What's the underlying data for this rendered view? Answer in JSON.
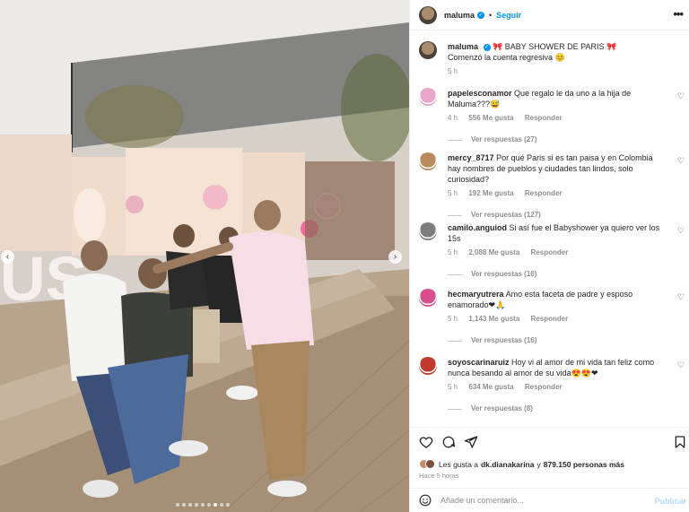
{
  "post_header": {
    "username": "maluma",
    "separator": "•",
    "follow_label": "Seguir",
    "more_label": "•••"
  },
  "caption": {
    "username": "maluma",
    "title": "🎀 BABY SHOWER DE PARIS 🎀",
    "text": "Comenzó la cuenta regresiva 😊",
    "time": "5 h"
  },
  "comments": [
    {
      "username": "papelesconamor",
      "text": "Que regalo le da uno a la hija de Maluma???😅",
      "time": "4 h",
      "likes": "556 Me gusta",
      "reply_label": "Responder",
      "view_replies": "Ver respuestas (27)",
      "avatar_color": "#e9a6c8"
    },
    {
      "username": "mercy_8717",
      "text": "Por qué Paris si es tan paisa y en Colombia hay nombres de pueblos y ciudades tan lindos, solo curiosidad?",
      "time": "5 h",
      "likes": "192 Me gusta",
      "reply_label": "Responder",
      "view_replies": "Ver respuestas (127)",
      "avatar_color": "#b88a5c"
    },
    {
      "username": "camilo.anguiod",
      "text": "Si así fue el Babyshower ya quiero ver los 15s",
      "time": "5 h",
      "likes": "2,088 Me gusta",
      "reply_label": "Responder",
      "view_replies": "Ver respuestas (16)",
      "avatar_color": "#7d7d7d"
    },
    {
      "username": "hecmaryutrera",
      "text": "Amo esta faceta de padre y esposo enamorado❤🙏",
      "time": "5 h",
      "likes": "1,143 Me gusta",
      "reply_label": "Responder",
      "view_replies": "Ver respuestas (16)",
      "avatar_color": "#d94f8b"
    },
    {
      "username": "soyoscarinaruiz",
      "text": "Hoy vi al amor de mi vida tan feliz como nunca besando al amor de su vida😍😍❤",
      "time": "5 h",
      "likes": "634 Me gusta",
      "reply_label": "Responder",
      "view_replies": "Ver respuestas (8)",
      "avatar_color": "#c0392b"
    }
  ],
  "likes_summary": {
    "prefix": "Les gusta a",
    "user": "dk.dianakarina",
    "connector": "y",
    "others": "879.150 personas más"
  },
  "time_ago": "Hace 5 horas",
  "add_comment": {
    "placeholder": "Añade un comentario...",
    "publish_label": "Publicar"
  },
  "icons": [
    "heart-icon",
    "comment-icon",
    "share-icon",
    "bookmark-icon",
    "emoji-icon",
    "verified-icon",
    "chevron-left-icon",
    "chevron-right-icon"
  ],
  "colors": {
    "accent": "#0095f6",
    "verified": "#0095f6",
    "muted": "#8e8e8e",
    "publish_disabled": "#b2dffc"
  },
  "carousel": {
    "total": 9,
    "active": 6
  }
}
